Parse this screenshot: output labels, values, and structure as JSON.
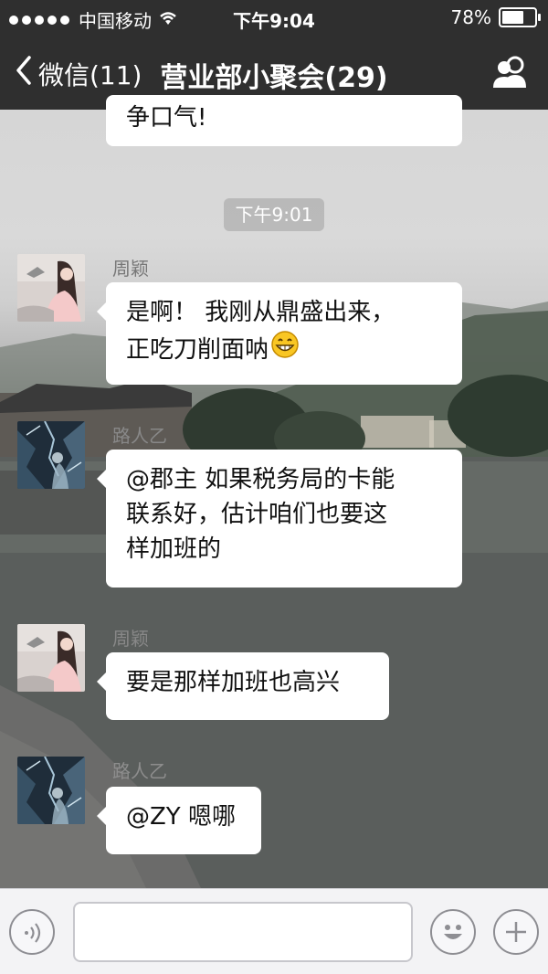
{
  "status_bar": {
    "carrier": "中国移动",
    "time": "下午9:04",
    "battery": "78%",
    "battery_level": 0.78
  },
  "nav": {
    "back_label": "微信(11)",
    "title": "营业部小聚会(29)"
  },
  "chat": {
    "partial_message": "争口气!",
    "timestamp": "下午9:01",
    "messages": [
      {
        "sender": "周颖",
        "text_lines": [
          "是啊！ 我刚从鼎盛出来，",
          "正吃刀削面呐"
        ]
      },
      {
        "sender": "路人乙",
        "text_lines": [
          "@郡主 如果税务局的卡能",
          "联系好，估计咱们也要这",
          "样加班的"
        ]
      },
      {
        "sender": "周颖",
        "text_lines": [
          "要是那样加班也高兴"
        ]
      },
      {
        "sender": "路人乙",
        "text_lines": [
          "@ZY 嗯哪"
        ]
      }
    ]
  },
  "icons": {
    "wifi": "wifi-icon",
    "back": "chevron-left-icon",
    "people": "group-info-icon",
    "voice": "voice-icon",
    "emoji": "emoji-icon",
    "plus": "plus-icon",
    "grin": "grin-emoji-icon"
  },
  "colors": {
    "bar": "#2f2f2f",
    "bubble": "#ffffff",
    "input_bar": "#f3f3f5"
  }
}
